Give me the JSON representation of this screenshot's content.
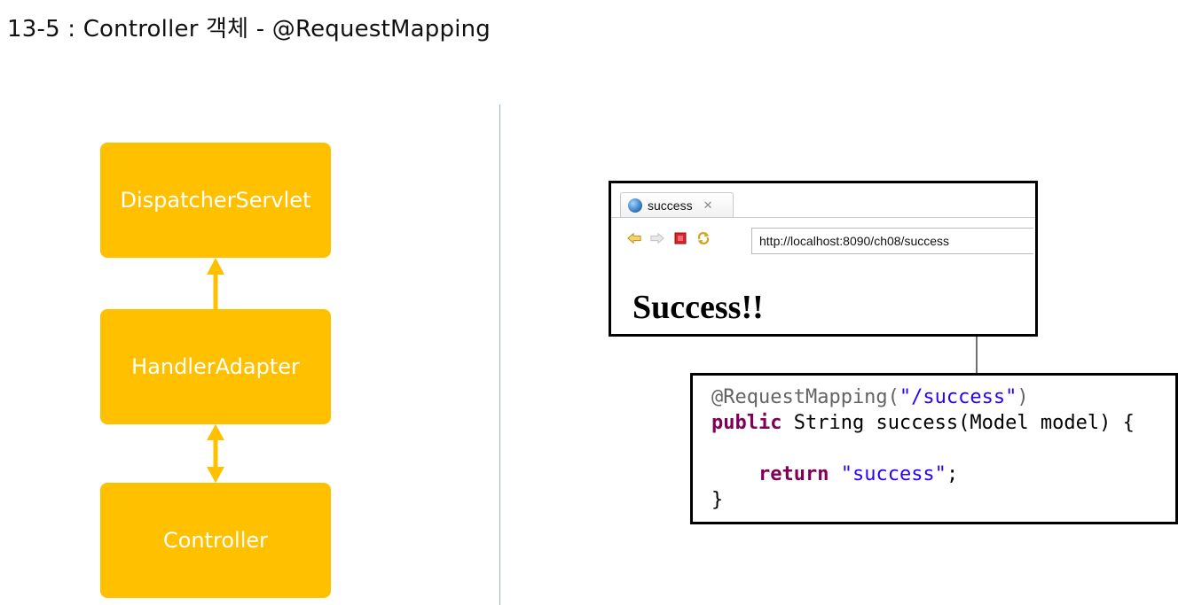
{
  "title": "13-5 : Controller 객체 - @RequestMapping",
  "flow": {
    "boxes": [
      {
        "label": "DispatcherServlet"
      },
      {
        "label": "HandlerAdapter"
      },
      {
        "label": "Controller"
      }
    ]
  },
  "browser": {
    "tab_label": "success",
    "tab_close": "✕",
    "url": "http://localhost:8090/ch08/success",
    "page_heading": "Success!!"
  },
  "code": {
    "annotation": "@RequestMapping(",
    "path_string": "\"/success\"",
    "annotation_close": ")",
    "kw_public": "public",
    "signature": " String success(Model model) {",
    "kw_return": "return",
    "return_value": "\"success\"",
    "semicolon": ";",
    "closing_brace": "}"
  },
  "colors": {
    "box_fill": "#FFC000",
    "arrow": "#FFC000",
    "divider": "#9fb3c8",
    "string": "#2a00ff",
    "keyword": "#7f0055",
    "annotation": "#646464"
  }
}
